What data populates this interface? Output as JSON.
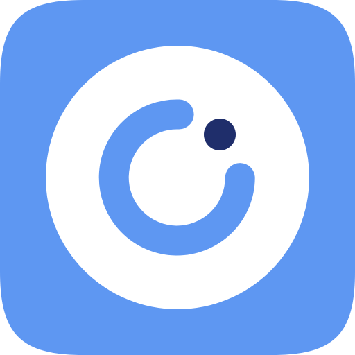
{
  "icon": {
    "name": "camera-app-icon",
    "colors": {
      "background": "#5E97F2",
      "lens_ring": "#FFFFFF",
      "arc": "#5E97F2",
      "dot": "#1F2E6B"
    }
  }
}
